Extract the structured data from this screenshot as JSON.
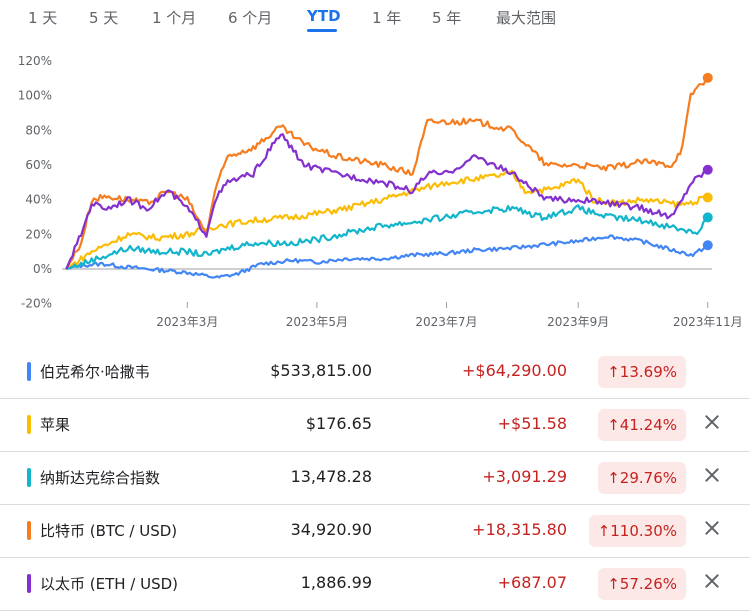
{
  "tabs": [
    {
      "label": "1 天",
      "active": false
    },
    {
      "label": "5 天",
      "active": false
    },
    {
      "label": "1 个月",
      "active": false
    },
    {
      "label": "6 个月",
      "active": false
    },
    {
      "label": "YTD",
      "active": true
    },
    {
      "label": "1 年",
      "active": false
    },
    {
      "label": "5 年",
      "active": false
    },
    {
      "label": "最大范围",
      "active": false
    }
  ],
  "chart_data": {
    "type": "line",
    "ylim": [
      -20,
      120
    ],
    "yticks": [
      -20,
      0,
      20,
      40,
      60,
      80,
      100,
      120
    ],
    "ytick_labels": [
      "-20%",
      "0%",
      "20%",
      "40%",
      "60%",
      "80%",
      "100%",
      "120%"
    ],
    "xticks": [
      "2023-03-01",
      "2023-05-01",
      "2023-07-01",
      "2023-09-01",
      "2023-11-01"
    ],
    "xtick_labels": [
      "2023年3月",
      "2023年5月",
      "2023年7月",
      "2023年9月",
      "2023年11月"
    ],
    "xlim": [
      "2023-01-01",
      "2023-11-03"
    ],
    "grid": false,
    "series": [
      {
        "name": "伯克希尔·哈撒韦",
        "color": "#4285f4",
        "x": [
          "2023-01-03",
          "2023-01-10",
          "2023-01-20",
          "2023-02-01",
          "2023-02-10",
          "2023-02-20",
          "2023-03-01",
          "2023-03-10",
          "2023-03-15",
          "2023-03-24",
          "2023-04-05",
          "2023-04-20",
          "2023-05-01",
          "2023-05-15",
          "2023-06-01",
          "2023-06-15",
          "2023-07-01",
          "2023-07-15",
          "2023-08-01",
          "2023-08-15",
          "2023-09-01",
          "2023-09-15",
          "2023-10-01",
          "2023-10-15",
          "2023-10-25",
          "2023-11-01"
        ],
        "values": [
          0,
          2,
          3,
          1,
          0,
          -1,
          -2,
          -4,
          -5,
          -3,
          3,
          5,
          4,
          6,
          6,
          8,
          9,
          11,
          12,
          14,
          16,
          19,
          16,
          11,
          8,
          13.69
        ]
      },
      {
        "name": "苹果",
        "color": "#fbbc04",
        "x": [
          "2023-01-03",
          "2023-01-15",
          "2023-02-01",
          "2023-02-15",
          "2023-03-01",
          "2023-03-15",
          "2023-04-01",
          "2023-04-20",
          "2023-05-01",
          "2023-05-15",
          "2023-06-01",
          "2023-06-15",
          "2023-07-01",
          "2023-07-15",
          "2023-08-01",
          "2023-08-07",
          "2023-08-20",
          "2023-09-01",
          "2023-09-08",
          "2023-09-20",
          "2023-10-01",
          "2023-10-20",
          "2023-11-01"
        ],
        "values": [
          0,
          10,
          20,
          18,
          20,
          25,
          28,
          30,
          32,
          35,
          40,
          45,
          50,
          52,
          55,
          45,
          46,
          52,
          40,
          38,
          40,
          37,
          41.24
        ]
      },
      {
        "name": "纳斯达克综合指数",
        "color": "#12b5cb",
        "x": [
          "2023-01-03",
          "2023-01-15",
          "2023-02-01",
          "2023-02-15",
          "2023-03-01",
          "2023-03-10",
          "2023-03-20",
          "2023-04-01",
          "2023-04-20",
          "2023-05-01",
          "2023-05-20",
          "2023-06-01",
          "2023-06-15",
          "2023-07-01",
          "2023-07-20",
          "2023-08-01",
          "2023-08-15",
          "2023-09-01",
          "2023-09-15",
          "2023-10-01",
          "2023-10-20",
          "2023-10-27",
          "2023-11-01"
        ],
        "values": [
          0,
          5,
          12,
          10,
          10,
          8,
          12,
          15,
          15,
          17,
          22,
          25,
          27,
          30,
          34,
          35,
          30,
          35,
          30,
          28,
          23,
          21,
          29.76
        ]
      },
      {
        "name": "比特币 (BTC / USD)",
        "color": "#f57c1f",
        "x": [
          "2023-01-03",
          "2023-01-10",
          "2023-01-15",
          "2023-01-22",
          "2023-02-01",
          "2023-02-10",
          "2023-02-20",
          "2023-03-01",
          "2023-03-10",
          "2023-03-14",
          "2023-03-20",
          "2023-04-01",
          "2023-04-14",
          "2023-04-25",
          "2023-05-10",
          "2023-06-01",
          "2023-06-15",
          "2023-06-22",
          "2023-07-01",
          "2023-07-15",
          "2023-08-01",
          "2023-08-17",
          "2023-09-01",
          "2023-09-15",
          "2023-10-01",
          "2023-10-15",
          "2023-10-20",
          "2023-10-24",
          "2023-10-27",
          "2023-11-01"
        ],
        "values": [
          0,
          15,
          40,
          42,
          40,
          38,
          45,
          40,
          20,
          45,
          65,
          70,
          82,
          72,
          65,
          60,
          55,
          85,
          85,
          85,
          80,
          60,
          60,
          58,
          62,
          60,
          70,
          100,
          105,
          110.3
        ]
      },
      {
        "name": "以太币 (ETH / USD)",
        "color": "#8430ce",
        "x": [
          "2023-01-03",
          "2023-01-10",
          "2023-01-15",
          "2023-01-22",
          "2023-02-01",
          "2023-02-10",
          "2023-02-20",
          "2023-03-01",
          "2023-03-10",
          "2023-03-14",
          "2023-03-20",
          "2023-04-01",
          "2023-04-14",
          "2023-04-25",
          "2023-05-10",
          "2023-06-01",
          "2023-06-15",
          "2023-06-22",
          "2023-07-01",
          "2023-07-15",
          "2023-08-01",
          "2023-08-17",
          "2023-09-01",
          "2023-09-15",
          "2023-10-01",
          "2023-10-15",
          "2023-10-20",
          "2023-10-24",
          "2023-11-01"
        ],
        "values": [
          0,
          20,
          38,
          35,
          40,
          35,
          45,
          35,
          20,
          40,
          50,
          55,
          78,
          60,
          55,
          50,
          45,
          55,
          55,
          65,
          55,
          40,
          40,
          38,
          35,
          30,
          40,
          50,
          57.26
        ]
      }
    ]
  },
  "holdings": [
    {
      "name": "伯克希尔·哈撒韦",
      "color": "#4285f4",
      "price": "$533,815.00",
      "change": "+$64,290.00",
      "percent": "13.69%",
      "removable": false
    },
    {
      "name": "苹果",
      "color": "#fbbc04",
      "price": "$176.65",
      "change": "+$51.58",
      "percent": "41.24%",
      "removable": true
    },
    {
      "name": "纳斯达克综合指数",
      "color": "#12b5cb",
      "price": "13,478.28",
      "change": "+3,091.29",
      "percent": "29.76%",
      "removable": true
    },
    {
      "name": "比特币 (BTC / USD)",
      "color": "#f57c1f",
      "price": "34,920.90",
      "change": "+18,315.80",
      "percent": "110.30%",
      "removable": true
    },
    {
      "name": "以太币 (ETH / USD)",
      "color": "#8430ce",
      "price": "1,886.99",
      "change": "+687.07",
      "percent": "57.26%",
      "removable": true
    }
  ]
}
